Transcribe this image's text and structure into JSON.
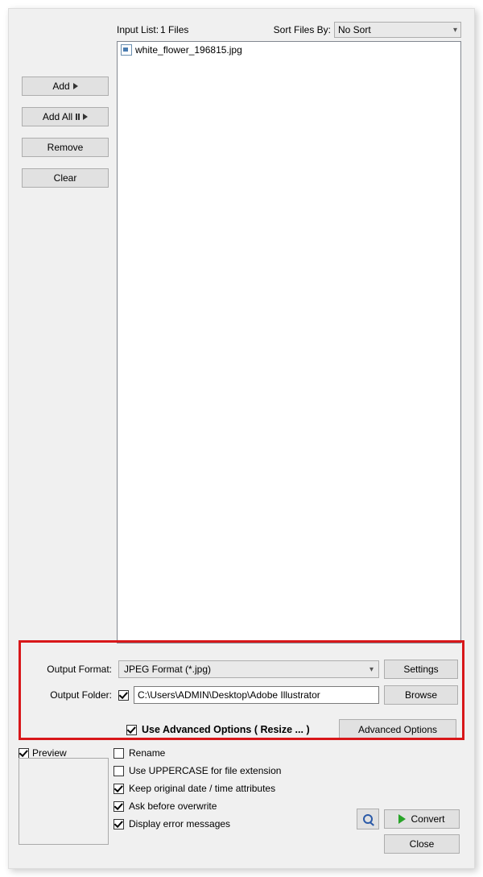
{
  "header": {
    "input_list_label": "Input List:",
    "input_list_count": "1 Files",
    "sort_files_label": "Sort Files By:",
    "sort_value": "No Sort"
  },
  "side_buttons": {
    "add": "Add",
    "add_all": "Add All",
    "remove": "Remove",
    "clear": "Clear"
  },
  "files": [
    {
      "name": "white_flower_196815.jpg"
    }
  ],
  "output": {
    "format_label": "Output Format:",
    "format_value": "JPEG Format (*.jpg)",
    "settings_btn": "Settings",
    "folder_label": "Output Folder:",
    "folder_value": "C:\\Users\\ADMIN\\Desktop\\Adobe Illustrator",
    "browse_btn": "Browse"
  },
  "advanced": {
    "use_adv_label": "Use Advanced Options ( Resize ... )",
    "adv_btn": "Advanced Options"
  },
  "preview": {
    "label": "Preview"
  },
  "options": {
    "rename": "Rename",
    "uppercase": "Use UPPERCASE for file extension",
    "keep_date": "Keep original date / time attributes",
    "ask_overwrite": "Ask before overwrite",
    "display_err": "Display error messages"
  },
  "bottom": {
    "convert": "Convert",
    "close": "Close"
  }
}
